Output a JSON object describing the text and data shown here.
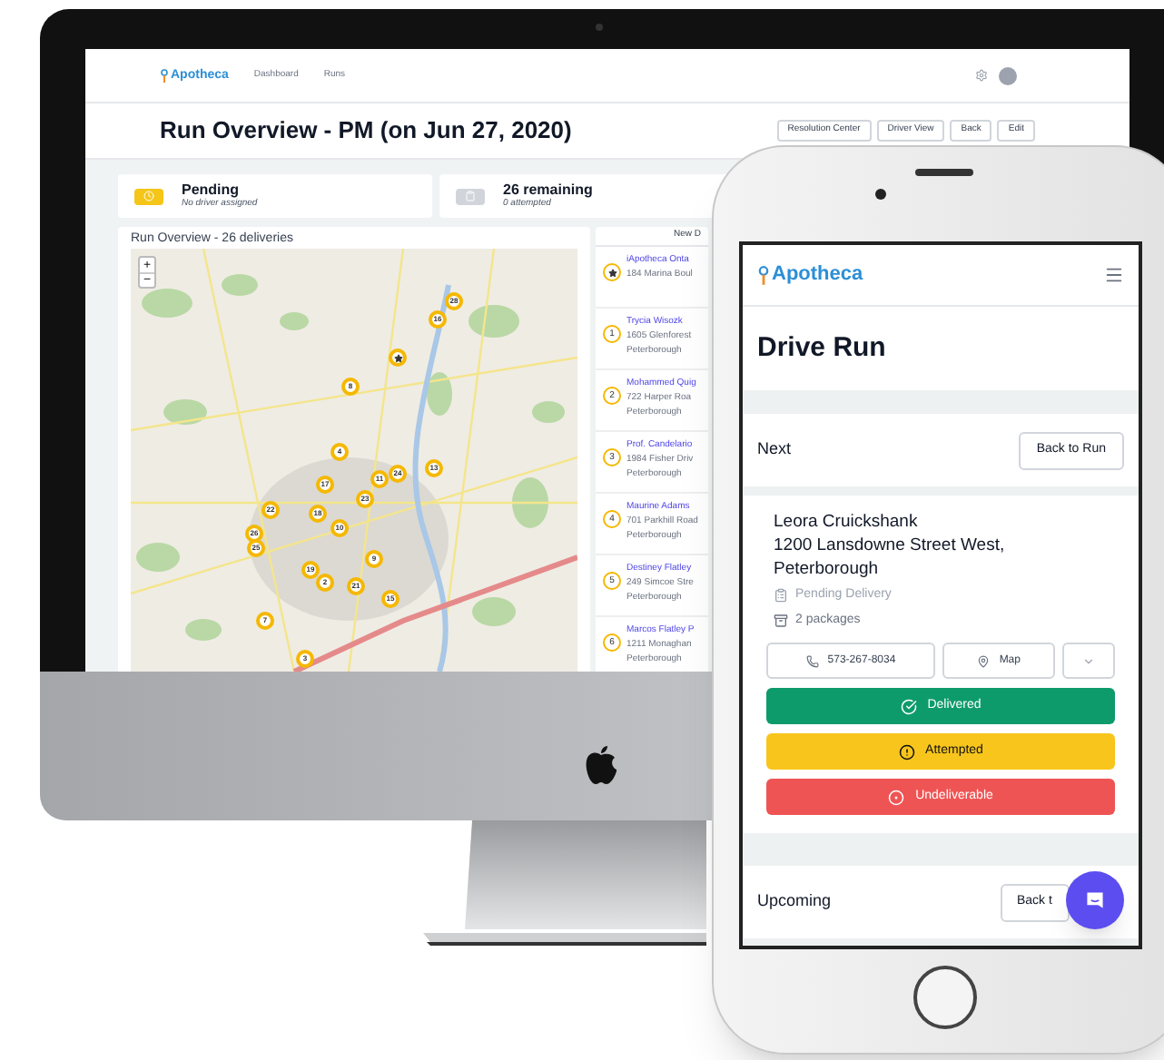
{
  "desktop": {
    "nav": {
      "logo": "Apotheca",
      "links": [
        {
          "label": "Dashboard"
        },
        {
          "label": "Runs"
        }
      ]
    },
    "title": "Run Overview - PM (on Jun 27, 2020)",
    "actions": [
      "Resolution Center",
      "Driver View",
      "Back",
      "Edit"
    ],
    "stats": [
      {
        "title": "Pending",
        "subtitle": "No driver assigned",
        "color": "#f5c518"
      },
      {
        "title": "26 remaining",
        "subtitle": "0 attempted",
        "color": "#d1d5db"
      }
    ],
    "map": {
      "title": "Run Overview - 26 deliveries",
      "zoom_in": "+",
      "zoom_out": "−",
      "markers": [
        {
          "kind": "number",
          "label": "28"
        },
        {
          "kind": "number",
          "label": "16"
        },
        {
          "kind": "depot"
        },
        {
          "kind": "number",
          "label": "8"
        },
        {
          "kind": "number",
          "label": "4"
        },
        {
          "kind": "number",
          "label": "24"
        },
        {
          "kind": "number",
          "label": "11"
        },
        {
          "kind": "number",
          "label": "13"
        },
        {
          "kind": "number",
          "label": "17"
        },
        {
          "kind": "number",
          "label": "23"
        },
        {
          "kind": "number",
          "label": "22"
        },
        {
          "kind": "number",
          "label": "18"
        },
        {
          "kind": "number",
          "label": "10"
        },
        {
          "kind": "number",
          "label": "26"
        },
        {
          "kind": "number",
          "label": "25"
        },
        {
          "kind": "number",
          "label": "19"
        },
        {
          "kind": "number",
          "label": "9"
        },
        {
          "kind": "number",
          "label": "2"
        },
        {
          "kind": "number",
          "label": "21"
        },
        {
          "kind": "number",
          "label": "15"
        },
        {
          "kind": "number",
          "label": "7"
        },
        {
          "kind": "number",
          "label": "3"
        }
      ]
    },
    "list": {
      "header": "New D",
      "items": [
        {
          "kind": "depot",
          "name": "iApotheca Onta",
          "address": [
            "184 Marina Boul"
          ]
        },
        {
          "kind": "number",
          "number": "1",
          "name": "Trycia Wisozk",
          "address": [
            "1605 Glenforest",
            "Peterborough"
          ]
        },
        {
          "kind": "number",
          "number": "2",
          "name": "Mohammed Quig",
          "address": [
            "722 Harper Roa",
            "Peterborough"
          ]
        },
        {
          "kind": "number",
          "number": "3",
          "name": "Prof. Candelario",
          "address": [
            "1984 Fisher Driv",
            "Peterborough"
          ]
        },
        {
          "kind": "number",
          "number": "4",
          "name": "Maurine Adams",
          "address": [
            "701 Parkhill Road",
            "Peterborough"
          ]
        },
        {
          "kind": "number",
          "number": "5",
          "name": "Destiney Flatley",
          "address": [
            "249 Simcoe Stre",
            "Peterborough"
          ]
        },
        {
          "kind": "number",
          "number": "6",
          "name": "Marcos Flatley P",
          "address": [
            "1211 Monaghan",
            "Peterborough"
          ]
        }
      ]
    }
  },
  "phone": {
    "logo": "Apotheca",
    "title": "Drive Run",
    "next": {
      "label": "Next",
      "button": "Back to Run"
    },
    "delivery": {
      "name": "Leora Cruickshank",
      "address": "1200 Lansdowne Street West, Peterborough",
      "status": "Pending Delivery",
      "packages": "2 packages",
      "phone": "573-267-8034",
      "map": "Map",
      "actions": [
        {
          "kind": "delivered",
          "label": "Delivered"
        },
        {
          "kind": "attempted",
          "label": "Attempted"
        },
        {
          "kind": "undeliverable",
          "label": "Undeliverable"
        }
      ]
    },
    "upcoming": {
      "label": "Upcoming",
      "button": "Back t"
    }
  }
}
